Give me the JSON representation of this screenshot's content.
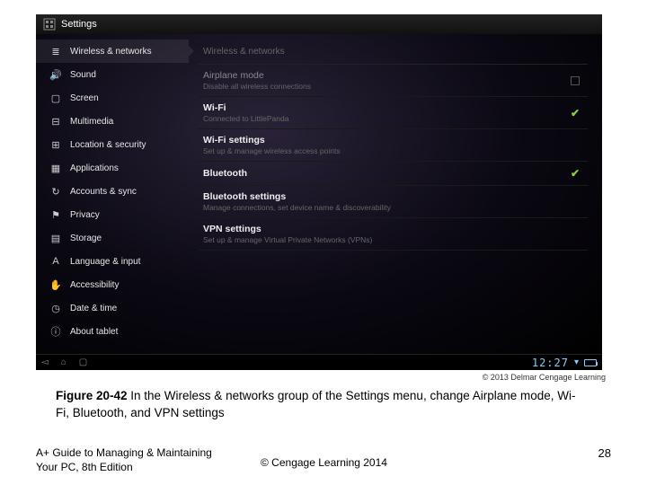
{
  "status": {
    "title": "Settings"
  },
  "sidebar": {
    "items": [
      {
        "label": "Wireless & networks",
        "icon": "≣"
      },
      {
        "label": "Sound",
        "icon": "🔊"
      },
      {
        "label": "Screen",
        "icon": "▢"
      },
      {
        "label": "Multimedia",
        "icon": "⊟"
      },
      {
        "label": "Location & security",
        "icon": "⊞"
      },
      {
        "label": "Applications",
        "icon": "▦"
      },
      {
        "label": "Accounts & sync",
        "icon": "↻"
      },
      {
        "label": "Privacy",
        "icon": "⚑"
      },
      {
        "label": "Storage",
        "icon": "▤"
      },
      {
        "label": "Language & input",
        "icon": "A"
      },
      {
        "label": "Accessibility",
        "icon": "✋"
      },
      {
        "label": "Date & time",
        "icon": "◷"
      },
      {
        "label": "About tablet",
        "icon": "ⓘ"
      }
    ]
  },
  "content": {
    "section_title": "Wireless & networks",
    "rows": [
      {
        "title": "Airplane mode",
        "sub": "Disable all wireless connections",
        "dim": true,
        "ctrl": "off"
      },
      {
        "title": "Wi-Fi",
        "sub": "Connected to LittlePanda",
        "ctrl": "on"
      },
      {
        "title": "Wi-Fi settings",
        "sub": "Set up & manage wireless access points",
        "ctrl": "none"
      },
      {
        "title": "Bluetooth",
        "sub": "",
        "ctrl": "on"
      },
      {
        "title": "Bluetooth settings",
        "sub": "Manage connections, set device name & discoverability",
        "ctrl": "none"
      },
      {
        "title": "VPN settings",
        "sub": "Set up & manage Virtual Private Networks (VPNs)",
        "ctrl": "none"
      }
    ]
  },
  "sysbar": {
    "time": "12:27"
  },
  "copyright_image": "© 2013 Delmar Cengage Learning",
  "caption_bold": "Figure 20-42",
  "caption_text": " In the Wireless & networks group of the Settings menu, change Airplane mode, Wi-Fi, Bluetooth, and VPN settings",
  "footer_left_1": "A+ Guide to Managing & Maintaining",
  "footer_left_2": "Your PC, 8th Edition",
  "footer_center": "© Cengage Learning 2014",
  "page_num": "28"
}
